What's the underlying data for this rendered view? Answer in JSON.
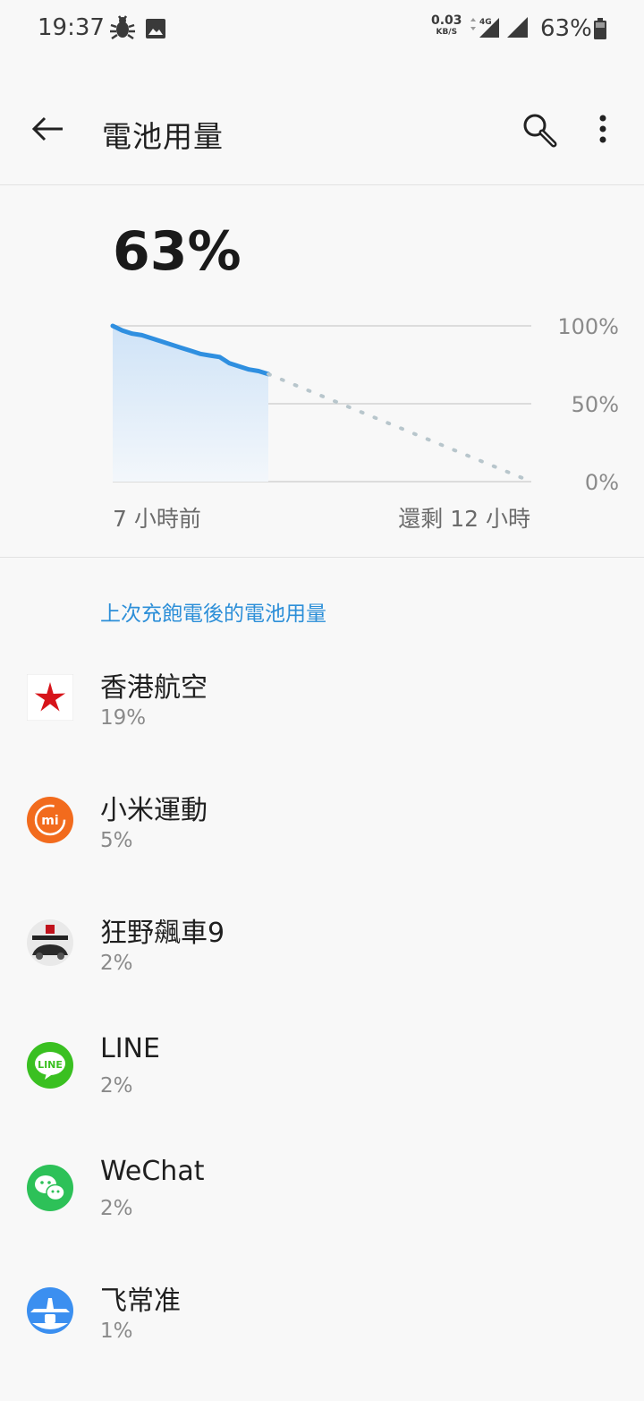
{
  "status_bar": {
    "time": "19:37",
    "net_speed": "0.03",
    "net_unit": "KB/S",
    "lte": "4G",
    "battery_percent": "63%"
  },
  "app_bar": {
    "title": "電池用量"
  },
  "battery": {
    "percent": "63%"
  },
  "chart_data": {
    "type": "line",
    "y_ticks": [
      "100%",
      "50%",
      "0%"
    ],
    "ylim": [
      0,
      100
    ],
    "x_labels": [
      "7 小時前",
      "還剩 12 小時"
    ],
    "series": [
      {
        "values": [
          100,
          97,
          95,
          94,
          92,
          90,
          88,
          86,
          84,
          82,
          81,
          80,
          76,
          74,
          72,
          71,
          69
        ],
        "color": "#2f8fe0"
      },
      {
        "values": [
          69,
          0
        ],
        "color": "#b8c6cc"
      }
    ]
  },
  "section": {
    "label": "上次充飽電後的電池用量"
  },
  "apps": [
    {
      "name": "香港航空",
      "pct": "19%",
      "icon": "hong-kong-airlines-icon"
    },
    {
      "name": "小米運動",
      "pct": "5%",
      "icon": "mi-fit-icon"
    },
    {
      "name": "狂野飆車9",
      "pct": "2%",
      "icon": "asphalt-9-icon"
    },
    {
      "name": "LINE",
      "pct": "2%",
      "icon": "line-icon"
    },
    {
      "name": "WeChat",
      "pct": "2%",
      "icon": "wechat-icon"
    },
    {
      "name": "飞常准",
      "pct": "1%",
      "icon": "variflight-icon"
    }
  ],
  "colors": {
    "accent": "#2d8fd8",
    "chart_line": "#2f8fe0",
    "projection": "#b8c6cc"
  }
}
